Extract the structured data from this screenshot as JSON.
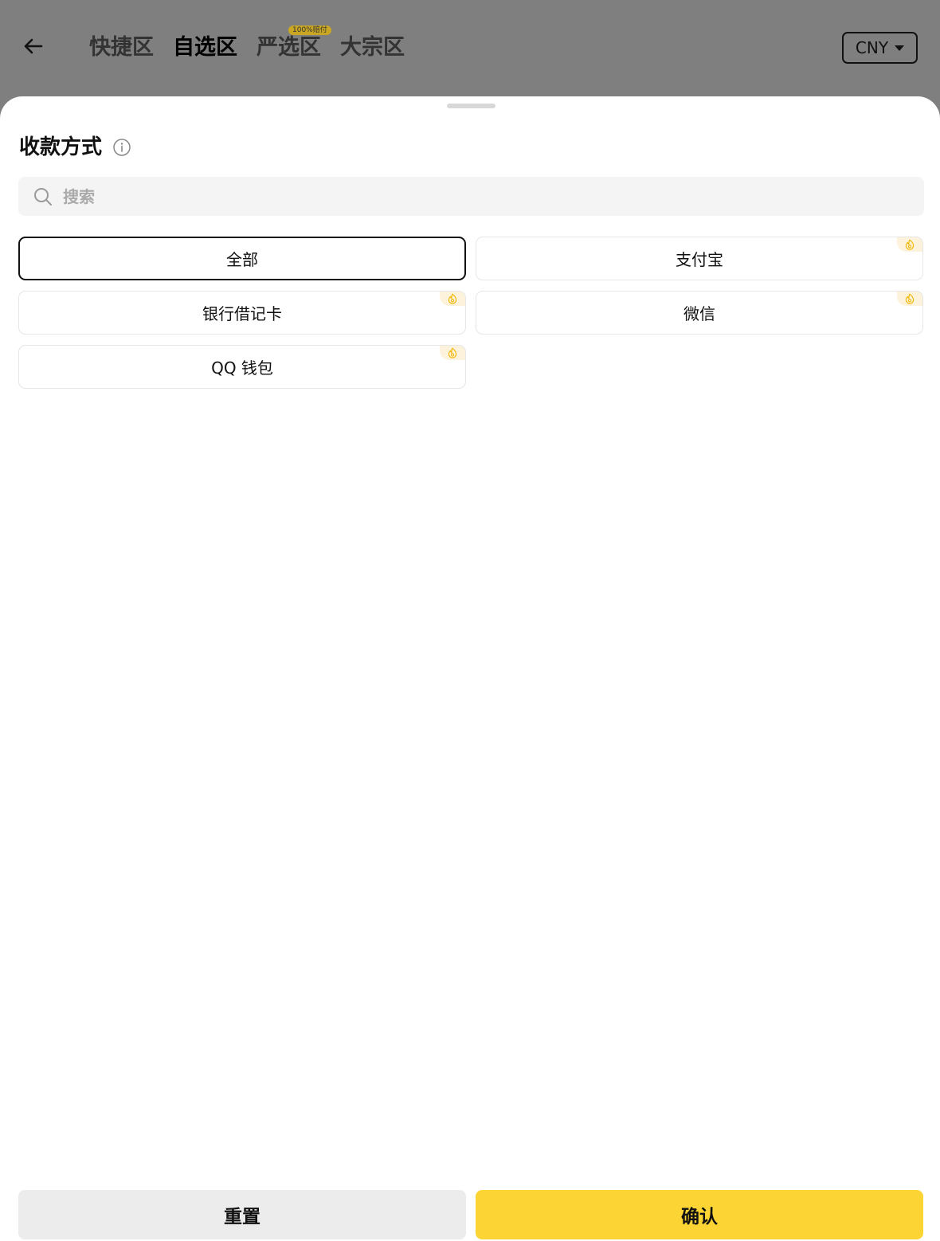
{
  "header": {
    "tabs": [
      {
        "label": "快捷区"
      },
      {
        "label": "自选区",
        "active": true
      },
      {
        "label": "严选区",
        "badge": "100%赔付"
      },
      {
        "label": "大宗区"
      }
    ],
    "currency": "CNY"
  },
  "sheet": {
    "title": "收款方式",
    "search_placeholder": "搜索",
    "options": [
      {
        "label": "全部",
        "selected": true,
        "hot": false
      },
      {
        "label": "支付宝",
        "selected": false,
        "hot": true
      },
      {
        "label": "银行借记卡",
        "selected": false,
        "hot": true
      },
      {
        "label": "微信",
        "selected": false,
        "hot": true
      },
      {
        "label": "QQ 钱包",
        "selected": false,
        "hot": true
      }
    ],
    "reset_label": "重置",
    "confirm_label": "确认"
  },
  "colors": {
    "accent": "#fcd535",
    "hot_icon": "#f0b90b",
    "overlay": "#7f7f7f"
  }
}
